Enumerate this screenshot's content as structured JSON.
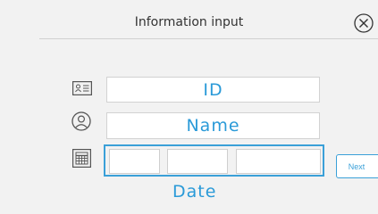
{
  "header": {
    "title": "Information input"
  },
  "form": {
    "id_placeholder": "ID",
    "name_placeholder": "Name",
    "date_label": "Date"
  },
  "actions": {
    "next_label": "Next"
  },
  "icons": {
    "close": "close-icon",
    "id_card": "id-card-icon",
    "user": "user-icon",
    "calendar": "calendar-icon"
  },
  "colors": {
    "accent": "#2a9ad8",
    "background": "#f2f2f2"
  }
}
